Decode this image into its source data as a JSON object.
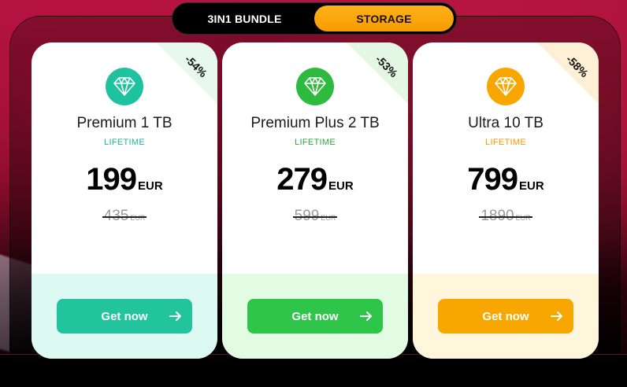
{
  "tabs": [
    {
      "label": "3IN1 BUNDLE",
      "active": false
    },
    {
      "label": "STORAGE",
      "active": true
    }
  ],
  "plans": [
    {
      "name": "Premium 1 TB",
      "period": "LIFETIME",
      "price": "199",
      "currency": "EUR",
      "old_price": "435",
      "old_currency": "EUR",
      "discount": "-54%",
      "button_label": "Get now",
      "icon": "diamond-icon",
      "accent": "#1fc29e",
      "period_color": "#1fb38f",
      "corner_color": "#e8f7ef",
      "bottom_color": "#dcfaf3",
      "button_color": "#22c49c"
    },
    {
      "name": "Premium Plus 2 TB",
      "period": "LIFETIME",
      "price": "279",
      "currency": "EUR",
      "old_price": "599",
      "old_currency": "EUR",
      "discount": "-53%",
      "button_label": "Get now",
      "icon": "diamond-icon",
      "accent": "#2dba3e",
      "period_color": "#2aa83a",
      "corner_color": "#e3f7e2",
      "bottom_color": "#e2fbe3",
      "button_color": "#2fc44a"
    },
    {
      "name": "Ultra 10 TB",
      "period": "LIFETIME",
      "price": "799",
      "currency": "EUR",
      "old_price": "1890",
      "old_currency": "EUR",
      "discount": "-58%",
      "button_label": "Get now",
      "icon": "diamond-icon",
      "accent": "#f7a700",
      "period_color": "#f29a00",
      "corner_color": "#fdf0d6",
      "bottom_color": "#fff6dc",
      "button_color": "#f8a700"
    }
  ]
}
